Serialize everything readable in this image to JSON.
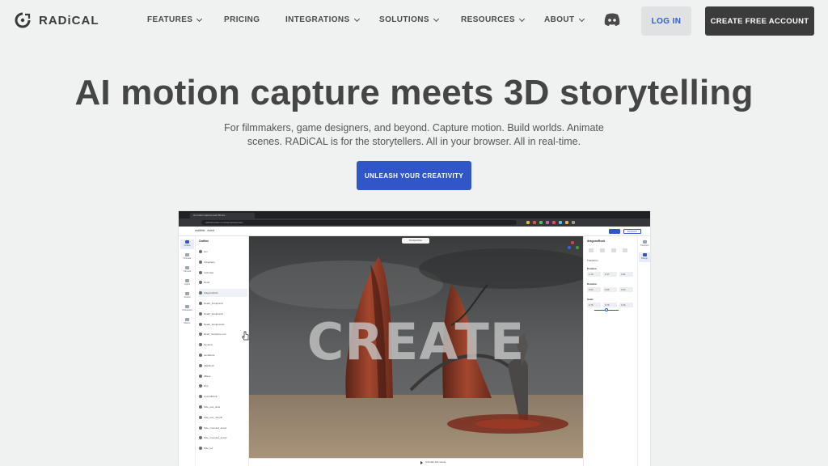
{
  "brand": {
    "name": "RADiCAL"
  },
  "nav": {
    "items": [
      {
        "label": "FEATURES",
        "dropdown": true
      },
      {
        "label": "PRICING",
        "dropdown": false
      },
      {
        "label": "INTEGRATIONS",
        "dropdown": true
      },
      {
        "label": "SOLUTIONS",
        "dropdown": true
      },
      {
        "label": "RESOURCES",
        "dropdown": true
      },
      {
        "label": "ABOUT",
        "dropdown": true
      }
    ],
    "login_label": "LOG IN",
    "create_account_label": "CREATE FREE ACCOUNT"
  },
  "hero": {
    "title": "AI motion capture meets 3D storytelling",
    "subtitle": "For filmmakers, game designers, and beyond. Capture motion. Build worlds. Animate scenes. RADiCAL is for the storytellers. All in your browser. All in real-time.",
    "cta_label": "UNLEASH YOUR CREATIVITY"
  },
  "app_preview": {
    "browser_tab": "AI motion capture and 3D scr...",
    "url": "radicalmotion.com/canvas/scenes/...",
    "project_title": "realtime - event",
    "export_label": "EXPORT",
    "viewport_mode": "Perspective",
    "overlay_text": "CREATE",
    "timeline_label": "Animate this scene",
    "left_rail": [
      {
        "label": "Outline",
        "active": true
      },
      {
        "label": "Animate",
        "active": false
      },
      {
        "label": "Camera",
        "active": false
      },
      {
        "label": "Lights",
        "active": false
      },
      {
        "label": "Assets",
        "active": false
      },
      {
        "label": "Characters",
        "active": false
      },
      {
        "label": "Motion",
        "active": false
      }
    ],
    "outline": {
      "title": "Outline",
      "items": [
        {
          "label": "box",
          "selected": false
        },
        {
          "label": "cubeplane",
          "selected": false
        },
        {
          "label": "rock tape",
          "selected": false
        },
        {
          "label": "cloud",
          "selected": false
        },
        {
          "label": "dragonsRock",
          "selected": true
        },
        {
          "label": "Death_Sculpture1",
          "selected": false
        },
        {
          "label": "Death_Sculpture2",
          "selected": false
        },
        {
          "label": "Death_Sculpture01",
          "selected": false
        },
        {
          "label": "DeeP_Sculpture.cmt",
          "selected": false
        },
        {
          "label": "dynamic",
          "selected": false
        },
        {
          "label": "sandRock",
          "selected": false
        },
        {
          "label": "rabbRock",
          "selected": false
        },
        {
          "label": "dBase",
          "selected": false
        },
        {
          "label": "ship",
          "selected": false
        },
        {
          "label": "syncedRock",
          "selected": false
        },
        {
          "label": "hide_rest_lacel",
          "selected": false
        },
        {
          "label": "hide_rest_rampD",
          "selected": false
        },
        {
          "label": "hide_mounted_area1",
          "selected": false
        },
        {
          "label": "hide_mounted_area2",
          "selected": false
        },
        {
          "label": "hide_ref",
          "selected": false
        }
      ]
    },
    "properties": {
      "title": "dragonsRock",
      "transform_label": "Transform",
      "position_label": "Position",
      "rotation_label": "Rotation",
      "scale_label": "Scale",
      "position": [
        "1.10",
        "0.17",
        "1.81"
      ],
      "rotation": [
        "0.00",
        "0.00",
        "0.00"
      ],
      "scale": [
        "0.76",
        "0.76",
        "0.76"
      ]
    },
    "right_rail": [
      {
        "label": "Transport",
        "active": false
      },
      {
        "label": "Design",
        "active": true
      }
    ]
  },
  "colors": {
    "background": "#f0f1f1",
    "primary_blue": "#3156c8",
    "dark_button": "#3b3b3b",
    "login_bg": "#dfe1e3"
  }
}
